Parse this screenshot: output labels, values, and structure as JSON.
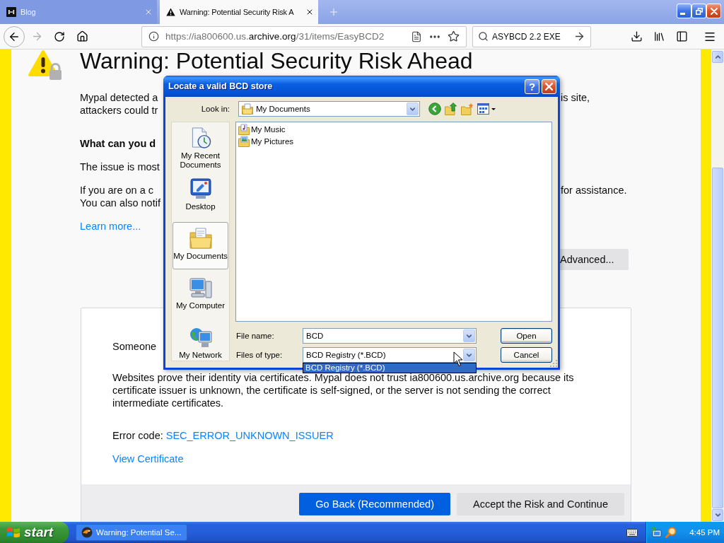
{
  "browser_tabs": [
    {
      "title": "Blog",
      "selected": false
    },
    {
      "title": "Warning: Potential Security Risk A",
      "selected": true
    }
  ],
  "address_bar": {
    "scheme_part": "https://ia800600.us.",
    "domain": "archive.org",
    "path": "/31/items/EasyBCD2"
  },
  "search_field": {
    "value": "ASYBCD 2.2 EXE"
  },
  "page": {
    "title": "Warning: Potential Security Risk Ahead",
    "intro_lines": [
      {
        "left": "Mypal detected a",
        "right": "is site,"
      },
      {
        "left": "attackers could tr"
      }
    ],
    "heading": "What can you d",
    "issue_lines": [
      {
        "left": "The issue is most"
      }
    ],
    "contact_lines": [
      {
        "left": "If you are on a c",
        "right": "for assistance."
      },
      {
        "left": "You can also notif"
      }
    ],
    "learn_more": "Learn more...",
    "advanced_button": "Advanced...",
    "details": {
      "lead": "Someone",
      "body": "Websites prove their identity via certificates. Mypal does not trust ia800600.us.archive.org because its certificate issuer is unknown, the certificate is self-signed, or the server is not sending the correct intermediate certificates.",
      "error_label": "Error code:",
      "error_code": "SEC_ERROR_UNKNOWN_ISSUER",
      "view_certificate": "View Certificate"
    },
    "buttons": [
      {
        "label": "Go Back (Recommended)",
        "kind": "primary"
      },
      {
        "label": "Accept the Risk and Continue",
        "kind": "secondary"
      }
    ]
  },
  "dialog": {
    "title": "Locate a valid BCD store",
    "help_label": "?",
    "look_in": {
      "label": "Look in:",
      "value": "My Documents"
    },
    "places": [
      {
        "label": "My Recent Documents",
        "kind": "recent",
        "selected": false
      },
      {
        "label": "Desktop",
        "kind": "desktop",
        "selected": false
      },
      {
        "label": "My Documents",
        "kind": "documents",
        "selected": true
      },
      {
        "label": "My Computer",
        "kind": "computer",
        "selected": false
      },
      {
        "label": "My Network",
        "kind": "network",
        "selected": false
      }
    ],
    "files": [
      {
        "name": "My Music",
        "kind": "music"
      },
      {
        "name": "My Pictures",
        "kind": "pictures"
      }
    ],
    "file_name": {
      "label": "File name:",
      "value": "BCD"
    },
    "file_type": {
      "label": "Files of type:",
      "value": "BCD Registry (*.BCD)",
      "expanded": true,
      "options": [
        {
          "label": "BCD Registry (*.BCD)",
          "selected": true
        }
      ]
    },
    "buttons": [
      {
        "label": "Open",
        "kind": "default"
      },
      {
        "label": "Cancel",
        "kind": "normal"
      }
    ]
  },
  "taskbar": {
    "start_label": "start",
    "tasks": [
      {
        "label": "Warning: Potential Se...",
        "selected": false
      }
    ],
    "clock": "4:45 PM"
  }
}
